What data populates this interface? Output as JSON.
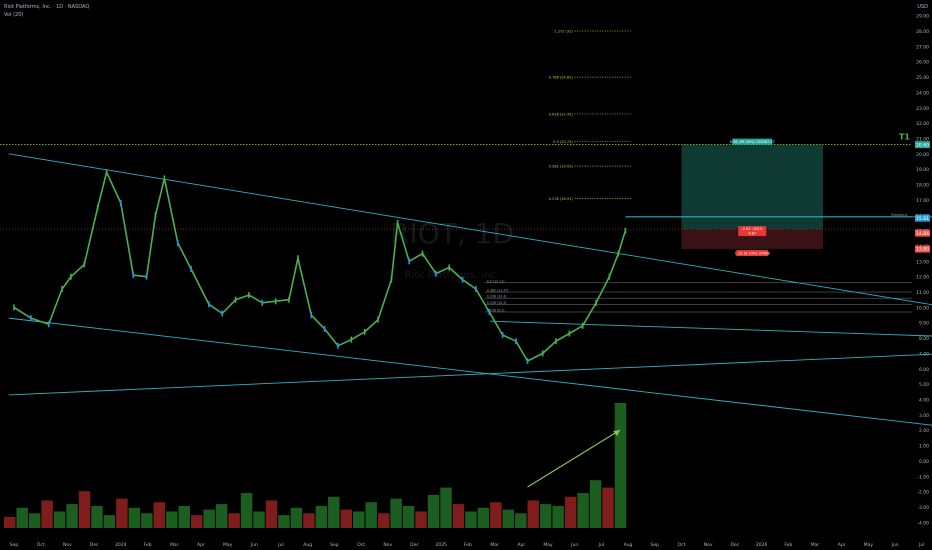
{
  "header": {
    "title": "Riot Platforms, Inc. · 1D · NASDAQ",
    "volume_label": "Vol (20)"
  },
  "watermark": {
    "symbol": "RIOT, 1D",
    "name": "Riot Platforms, Inc."
  },
  "price_axis": {
    "currency": "USD",
    "ticks": [
      "29.00",
      "28.00",
      "27.00",
      "26.00",
      "25.00",
      "24.00",
      "23.00",
      "22.00",
      "21.00",
      "20.00",
      "19.00",
      "18.00",
      "17.00",
      "16.00",
      "15.00",
      "14.00",
      "13.00",
      "12.00",
      "11.00",
      "10.00",
      "9.00",
      "8.00",
      "7.00",
      "6.00",
      "5.00",
      "4.00",
      "3.00",
      "2.00",
      "1.00",
      "0.00",
      "-1.00",
      "-2.00",
      "-3.00",
      "-4.00"
    ],
    "badges": [
      {
        "name": "target-badge",
        "value": "20.60",
        "color": "#26a69a"
      },
      {
        "name": "entry-badge",
        "value": "15.81",
        "color": "#2a9fd6"
      },
      {
        "name": "current-badge",
        "value": "14.84",
        "color": "#ef5350"
      },
      {
        "name": "stop-badge",
        "value": "13.80",
        "color": "#ef5350"
      }
    ]
  },
  "time_axis": [
    "Sep",
    "Oct",
    "Nov",
    "Dec",
    "2024",
    "Feb",
    "Mar",
    "Apr",
    "May",
    "Jun",
    "Jul",
    "Aug",
    "Sep",
    "Oct",
    "Nov",
    "Dec",
    "2025",
    "Feb",
    "Mar",
    "Apr",
    "May",
    "Jun",
    "Jul",
    "Aug",
    "Sep",
    "Oct",
    "Nov",
    "Dec",
    "2026",
    "Feb",
    "Mar",
    "Apr",
    "May",
    "Jun",
    "Jul"
  ],
  "annotations": {
    "target_marker": "T1",
    "breakout_label": "Breakout",
    "position_profit_label": "5.58 (36.30%) 105087.47",
    "position_mid_label": "-0.61 -101%",
    "position_mid_sub": "4.87",
    "position_loss_label": "1.25 (8.14%) 37488",
    "fib_labels": [
      "1.272 (31)",
      "0.786 (24.82)",
      "0.618 (22.45)",
      "0.5 (20.74)",
      "0.382 (19.03)",
      "0.236 (16.91)"
    ],
    "retracement_labels": [
      "0.5 (12.11)",
      "0.382 (11.37)",
      "0.236 (10.4)",
      "0.236 (10.3)",
      "0.236 (9.5)"
    ]
  },
  "colors": {
    "background": "#000000",
    "candle_up": "#4caf50",
    "candle_down": "#2196f3",
    "trendline": "#2ab3c6",
    "fib_line": "#b9d633",
    "profit_zone": "#0f3a33",
    "loss_zone": "#3a1216",
    "arrow": "#8bc34a",
    "volume_up": "#1b5e20",
    "volume_down": "#7f1d1d"
  },
  "chart_data": {
    "type": "candlestick",
    "ylim": [
      -4.5,
      29.5
    ],
    "series": [
      {
        "name": "price",
        "points": [
          [
            "2023-09-01",
            10.0
          ],
          [
            "2023-09-20",
            9.3
          ],
          [
            "2023-10-10",
            8.9
          ],
          [
            "2023-10-25",
            11.2
          ],
          [
            "2023-11-05",
            12.0
          ],
          [
            "2023-11-20",
            12.8
          ],
          [
            "2023-12-05",
            16.5
          ],
          [
            "2023-12-15",
            18.8
          ],
          [
            "2024-01-01",
            16.8
          ],
          [
            "2024-01-15",
            12.1
          ],
          [
            "2024-01-30",
            12.0
          ],
          [
            "2024-02-10",
            16.0
          ],
          [
            "2024-02-20",
            18.4
          ],
          [
            "2024-03-05",
            14.2
          ],
          [
            "2024-03-20",
            12.5
          ],
          [
            "2024-04-10",
            10.2
          ],
          [
            "2024-04-25",
            9.6
          ],
          [
            "2024-05-10",
            10.5
          ],
          [
            "2024-05-25",
            10.8
          ],
          [
            "2024-06-10",
            10.3
          ],
          [
            "2024-06-25",
            10.4
          ],
          [
            "2024-07-10",
            10.5
          ],
          [
            "2024-07-20",
            13.2
          ],
          [
            "2024-08-05",
            9.5
          ],
          [
            "2024-08-20",
            8.6
          ],
          [
            "2024-09-05",
            7.5
          ],
          [
            "2024-09-20",
            7.9
          ],
          [
            "2024-10-05",
            8.4
          ],
          [
            "2024-10-20",
            9.2
          ],
          [
            "2024-11-05",
            11.8
          ],
          [
            "2024-11-12",
            15.5
          ],
          [
            "2024-11-25",
            13.0
          ],
          [
            "2024-12-10",
            13.5
          ],
          [
            "2024-12-25",
            12.2
          ],
          [
            "2025-01-10",
            12.6
          ],
          [
            "2025-01-25",
            11.8
          ],
          [
            "2025-02-10",
            11.2
          ],
          [
            "2025-02-25",
            9.7
          ],
          [
            "2025-03-10",
            8.2
          ],
          [
            "2025-03-25",
            7.8
          ],
          [
            "2025-04-08",
            6.5
          ],
          [
            "2025-04-25",
            7.0
          ],
          [
            "2025-05-10",
            7.8
          ],
          [
            "2025-05-25",
            8.3
          ],
          [
            "2025-06-10",
            8.8
          ],
          [
            "2025-06-25",
            10.3
          ],
          [
            "2025-07-10",
            12.0
          ],
          [
            "2025-07-20",
            13.5
          ],
          [
            "2025-07-28",
            15.0
          ]
        ]
      },
      {
        "name": "volume",
        "values": [
          0.6,
          1.1,
          0.8,
          1.5,
          0.9,
          1.3,
          2.0,
          1.2,
          0.7,
          1.6,
          1.1,
          0.8,
          1.4,
          0.9,
          1.2,
          0.7,
          1.0,
          1.3,
          0.8,
          1.9,
          0.9,
          1.5,
          0.7,
          1.1,
          0.8,
          1.2,
          1.7,
          1.0,
          0.9,
          1.4,
          0.8,
          1.6,
          1.2,
          0.9,
          1.8,
          2.2,
          1.3,
          0.9,
          1.1,
          1.4,
          1.0,
          0.8,
          1.5,
          1.3,
          1.2,
          1.7,
          1.9,
          2.6,
          2.2,
          6.8
        ]
      }
    ],
    "trendlines": [
      {
        "from": [
          "2023-08-25",
          20.0
        ],
        "to": [
          "2026-07-31",
          10.0
        ]
      },
      {
        "from": [
          "2023-08-25",
          9.3
        ],
        "to": [
          "2026-07-31",
          2.2
        ]
      },
      {
        "from": [
          "2023-08-25",
          4.3
        ],
        "to": [
          "2026-07-31",
          7.0
        ]
      },
      {
        "from": [
          "2025-02-26",
          9.1
        ],
        "to": [
          "2026-07-31",
          8.1
        ]
      },
      {
        "from": [
          "2025-07-28",
          15.9
        ],
        "to": [
          "2026-07-31",
          15.9
        ]
      }
    ],
    "fib_levels": [
      {
        "label": "1.272 (31)",
        "value": 28.0
      },
      {
        "label": "0.786 (24.82)",
        "value": 25.0
      },
      {
        "label": "0.618 (22.45)",
        "value": 22.6
      },
      {
        "label": "0.5 (20.74)",
        "value": 20.8
      },
      {
        "label": "0.382 (19.03)",
        "value": 19.2
      },
      {
        "label": "0.236 (16.91)",
        "value": 17.1
      }
    ],
    "position": {
      "entry": 15.1,
      "target": 20.6,
      "stop": 13.8,
      "start": "2025-10-01",
      "end": "2026-03-10"
    }
  }
}
